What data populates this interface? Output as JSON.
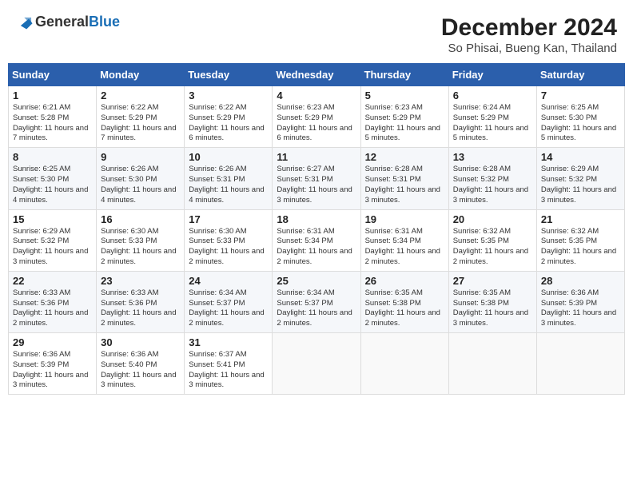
{
  "header": {
    "logo_line1": "General",
    "logo_line2": "Blue",
    "title": "December 2024",
    "subtitle": "So Phisai, Bueng Kan, Thailand"
  },
  "weekdays": [
    "Sunday",
    "Monday",
    "Tuesday",
    "Wednesday",
    "Thursday",
    "Friday",
    "Saturday"
  ],
  "weeks": [
    [
      {
        "day": "1",
        "sunrise": "6:21 AM",
        "sunset": "5:28 PM",
        "daylight": "11 hours and 7 minutes."
      },
      {
        "day": "2",
        "sunrise": "6:22 AM",
        "sunset": "5:29 PM",
        "daylight": "11 hours and 7 minutes."
      },
      {
        "day": "3",
        "sunrise": "6:22 AM",
        "sunset": "5:29 PM",
        "daylight": "11 hours and 6 minutes."
      },
      {
        "day": "4",
        "sunrise": "6:23 AM",
        "sunset": "5:29 PM",
        "daylight": "11 hours and 6 minutes."
      },
      {
        "day": "5",
        "sunrise": "6:23 AM",
        "sunset": "5:29 PM",
        "daylight": "11 hours and 5 minutes."
      },
      {
        "day": "6",
        "sunrise": "6:24 AM",
        "sunset": "5:29 PM",
        "daylight": "11 hours and 5 minutes."
      },
      {
        "day": "7",
        "sunrise": "6:25 AM",
        "sunset": "5:30 PM",
        "daylight": "11 hours and 5 minutes."
      }
    ],
    [
      {
        "day": "8",
        "sunrise": "6:25 AM",
        "sunset": "5:30 PM",
        "daylight": "11 hours and 4 minutes."
      },
      {
        "day": "9",
        "sunrise": "6:26 AM",
        "sunset": "5:30 PM",
        "daylight": "11 hours and 4 minutes."
      },
      {
        "day": "10",
        "sunrise": "6:26 AM",
        "sunset": "5:31 PM",
        "daylight": "11 hours and 4 minutes."
      },
      {
        "day": "11",
        "sunrise": "6:27 AM",
        "sunset": "5:31 PM",
        "daylight": "11 hours and 3 minutes."
      },
      {
        "day": "12",
        "sunrise": "6:28 AM",
        "sunset": "5:31 PM",
        "daylight": "11 hours and 3 minutes."
      },
      {
        "day": "13",
        "sunrise": "6:28 AM",
        "sunset": "5:32 PM",
        "daylight": "11 hours and 3 minutes."
      },
      {
        "day": "14",
        "sunrise": "6:29 AM",
        "sunset": "5:32 PM",
        "daylight": "11 hours and 3 minutes."
      }
    ],
    [
      {
        "day": "15",
        "sunrise": "6:29 AM",
        "sunset": "5:32 PM",
        "daylight": "11 hours and 3 minutes."
      },
      {
        "day": "16",
        "sunrise": "6:30 AM",
        "sunset": "5:33 PM",
        "daylight": "11 hours and 2 minutes."
      },
      {
        "day": "17",
        "sunrise": "6:30 AM",
        "sunset": "5:33 PM",
        "daylight": "11 hours and 2 minutes."
      },
      {
        "day": "18",
        "sunrise": "6:31 AM",
        "sunset": "5:34 PM",
        "daylight": "11 hours and 2 minutes."
      },
      {
        "day": "19",
        "sunrise": "6:31 AM",
        "sunset": "5:34 PM",
        "daylight": "11 hours and 2 minutes."
      },
      {
        "day": "20",
        "sunrise": "6:32 AM",
        "sunset": "5:35 PM",
        "daylight": "11 hours and 2 minutes."
      },
      {
        "day": "21",
        "sunrise": "6:32 AM",
        "sunset": "5:35 PM",
        "daylight": "11 hours and 2 minutes."
      }
    ],
    [
      {
        "day": "22",
        "sunrise": "6:33 AM",
        "sunset": "5:36 PM",
        "daylight": "11 hours and 2 minutes."
      },
      {
        "day": "23",
        "sunrise": "6:33 AM",
        "sunset": "5:36 PM",
        "daylight": "11 hours and 2 minutes."
      },
      {
        "day": "24",
        "sunrise": "6:34 AM",
        "sunset": "5:37 PM",
        "daylight": "11 hours and 2 minutes."
      },
      {
        "day": "25",
        "sunrise": "6:34 AM",
        "sunset": "5:37 PM",
        "daylight": "11 hours and 2 minutes."
      },
      {
        "day": "26",
        "sunrise": "6:35 AM",
        "sunset": "5:38 PM",
        "daylight": "11 hours and 2 minutes."
      },
      {
        "day": "27",
        "sunrise": "6:35 AM",
        "sunset": "5:38 PM",
        "daylight": "11 hours and 3 minutes."
      },
      {
        "day": "28",
        "sunrise": "6:36 AM",
        "sunset": "5:39 PM",
        "daylight": "11 hours and 3 minutes."
      }
    ],
    [
      {
        "day": "29",
        "sunrise": "6:36 AM",
        "sunset": "5:39 PM",
        "daylight": "11 hours and 3 minutes."
      },
      {
        "day": "30",
        "sunrise": "6:36 AM",
        "sunset": "5:40 PM",
        "daylight": "11 hours and 3 minutes."
      },
      {
        "day": "31",
        "sunrise": "6:37 AM",
        "sunset": "5:41 PM",
        "daylight": "11 hours and 3 minutes."
      },
      null,
      null,
      null,
      null
    ]
  ]
}
